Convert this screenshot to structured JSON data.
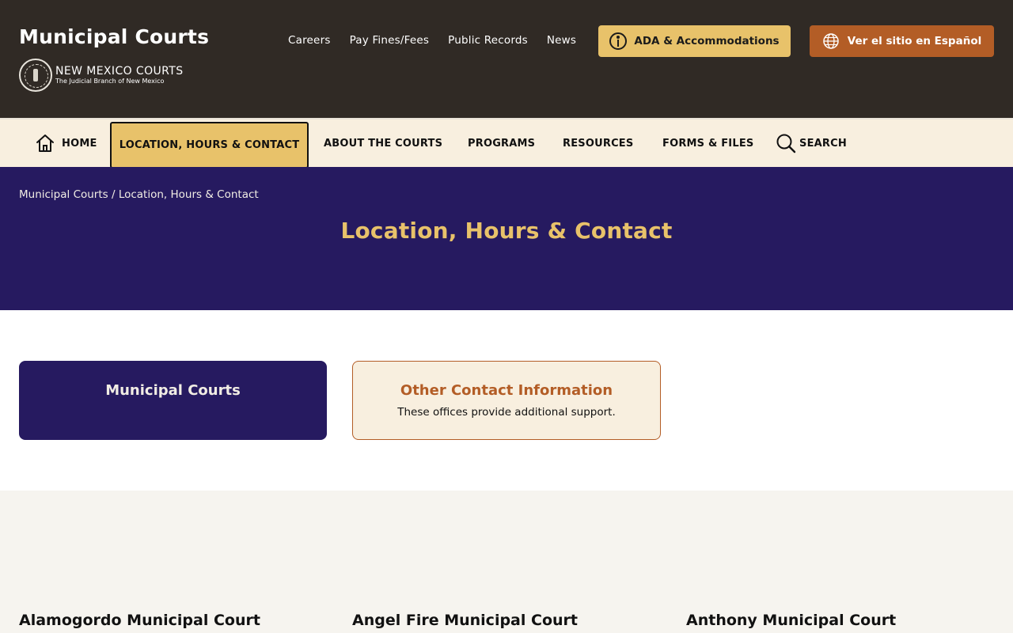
{
  "header": {
    "site_title": "Municipal Courts",
    "brand_name": "NEW MEXICO COURTS",
    "brand_sub": "The Judicial Branch of New Mexico",
    "utility_links": [
      "Careers",
      "Pay Fines/Fees",
      "Public Records",
      "News"
    ],
    "ada_button": "ADA & Accommodations",
    "spanish_button": "Ver el sitio en Español"
  },
  "nav": {
    "home": "HOME",
    "location": "LOCATION, HOURS & CONTACT",
    "about": "ABOUT THE COURTS",
    "programs": "PROGRAMS",
    "resources": "RESOURCES",
    "forms": "FORMS & FILES",
    "search": "SEARCH"
  },
  "hero": {
    "breadcrumb": "Municipal Courts / Location, Hours & Contact",
    "title": "Location, Hours & Contact"
  },
  "cards": {
    "primary_title": "Municipal Courts",
    "secondary_title": "Other Contact Information",
    "secondary_desc": "These offices provide additional support."
  },
  "courts": [
    "Alamogordo Municipal Court",
    "Angel Fire Municipal Court",
    "Anthony Municipal Court"
  ],
  "colors": {
    "header_bg": "#302a25",
    "accent_gold": "#e8c26a",
    "accent_orange": "#b35d26",
    "hero_bg": "#261a60",
    "nav_bg": "#f8efdf"
  },
  "icons": {
    "ada": "accessibility-icon",
    "spanish": "globe-icon",
    "home": "home-icon",
    "search": "search-icon",
    "seal": "state-seal-logo"
  }
}
